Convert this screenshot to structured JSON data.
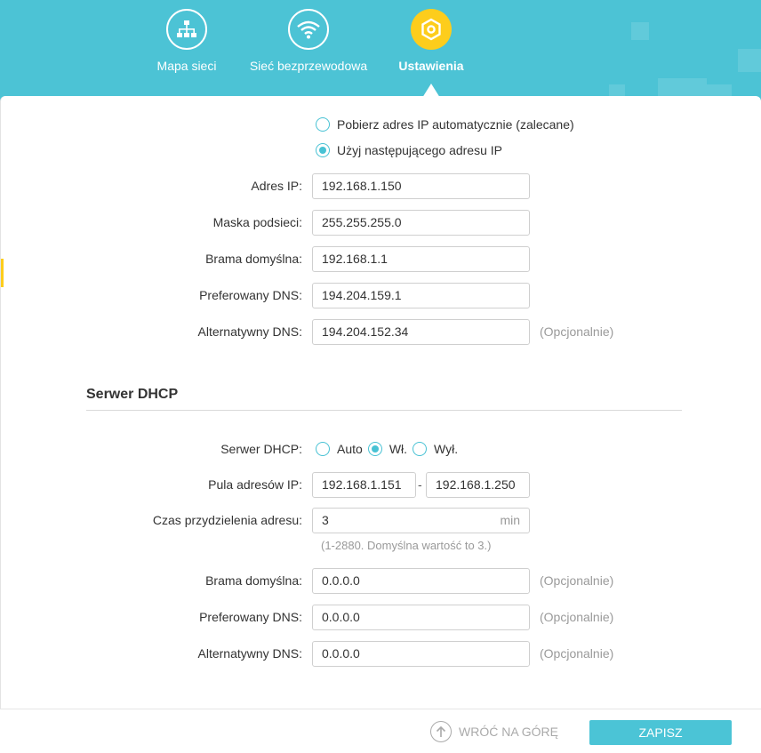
{
  "nav": {
    "items": [
      {
        "label": "Mapa sieci",
        "icon": "network-map-icon"
      },
      {
        "label": "Sieć bezprzewodowa",
        "icon": "wifi-icon"
      },
      {
        "label": "Ustawienia",
        "icon": "settings-gear-icon"
      }
    ],
    "active": "Ustawienia"
  },
  "lan": {
    "radio_auto_label": "Pobierz adres IP automatycznie (zalecane)",
    "radio_manual_label": "Użyj następującego adresu IP",
    "selected": "manual",
    "ip_label": "Adres IP:",
    "ip_value": "192.168.1.150",
    "mask_label": "Maska podsieci:",
    "mask_value": "255.255.255.0",
    "gateway_label": "Brama domyślna:",
    "gateway_value": "192.168.1.1",
    "dns1_label": "Preferowany DNS:",
    "dns1_value": "194.204.159.1",
    "dns2_label": "Alternatywny DNS:",
    "dns2_value": "194.204.152.34",
    "optional": "(Opcjonalnie)"
  },
  "dhcp": {
    "title": "Serwer DHCP",
    "server_label": "Serwer DHCP:",
    "options": [
      "Auto",
      "Wł.",
      "Wył."
    ],
    "selected": "Wł.",
    "pool_label": "Pula adresów IP:",
    "pool_start": "192.168.1.151",
    "pool_sep": "-",
    "pool_end": "192.168.1.250",
    "lease_label": "Czas przydzielenia adresu:",
    "lease_value": "3",
    "lease_unit": "min",
    "lease_hint": "(1-2880. Domyślna wartość to 3.)",
    "gateway_label": "Brama domyślna:",
    "gateway_value": "0.0.0.0",
    "dns1_label": "Preferowany DNS:",
    "dns1_value": "0.0.0.0",
    "dns2_label": "Alternatywny DNS:",
    "dns2_value": "0.0.0.0",
    "optional": "(Opcjonalnie)"
  },
  "footer": {
    "back_to_top": "WRÓĆ NA GÓRĘ",
    "save": "ZAPISZ"
  },
  "colors": {
    "brand": "#4cc3d5",
    "active_icon": "#fdcd1c"
  }
}
